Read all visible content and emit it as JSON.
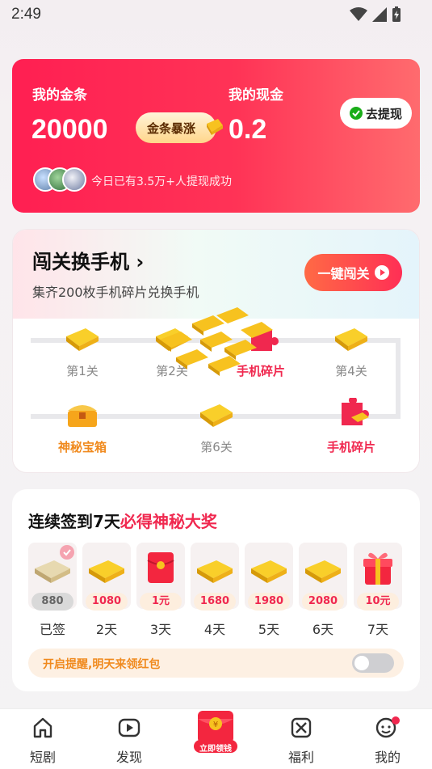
{
  "status_bar": {
    "time": "2:49"
  },
  "wallet": {
    "gold_label": "我的金条",
    "gold_value": "20000",
    "boom_badge": "金条暴涨",
    "cash_label": "我的现金",
    "cash_value": "0.2",
    "withdraw_label": "去提现",
    "success_text": "今日已有3.5万+人提现成功"
  },
  "level_challenge": {
    "title": "闯关换手机",
    "subtitle": "集齐200枚手机碎片兑换手机",
    "go_button": "一键闯关",
    "stages": [
      {
        "label": "第1关",
        "icon": "gold-bars-icon"
      },
      {
        "label": "第2关",
        "icon": "gold-bars-icon"
      },
      {
        "label": "手机碎片",
        "icon": "puzzle-piece-icon"
      },
      {
        "label": "第4关",
        "icon": "gold-bars-icon"
      },
      {
        "label": "神秘宝箱",
        "icon": "treasure-chest-icon"
      },
      {
        "label": "第6关",
        "icon": "gold-bars-icon"
      },
      {
        "label": "手机碎片",
        "icon": "puzzle-piece-icon"
      }
    ]
  },
  "checkin": {
    "title_prefix": "连续签到7天",
    "title_highlight": "必得神秘大奖",
    "days": [
      {
        "amount": "880",
        "label": "已签",
        "icon": "gold-bars-icon",
        "done": true
      },
      {
        "amount": "1080",
        "label": "2天",
        "icon": "gold-bars-icon"
      },
      {
        "amount": "1元",
        "label": "3天",
        "icon": "red-envelope-icon"
      },
      {
        "amount": "1680",
        "label": "4天",
        "icon": "gold-bars-icon"
      },
      {
        "amount": "1980",
        "label": "5天",
        "icon": "gold-bars-icon"
      },
      {
        "amount": "2080",
        "label": "6天",
        "icon": "gold-bars-icon"
      },
      {
        "amount": "10元",
        "label": "7天",
        "icon": "gift-box-icon"
      }
    ],
    "reminder_text": "开启提醒,明天来领红包",
    "reminder_on": false
  },
  "bottom_nav": {
    "items": [
      {
        "label": "短剧",
        "icon": "home-icon"
      },
      {
        "label": "发现",
        "icon": "play-icon"
      },
      {
        "label": "立即领钱",
        "icon": "red-envelope-icon"
      },
      {
        "label": "福利",
        "icon": "welfare-icon"
      },
      {
        "label": "我的",
        "icon": "profile-icon"
      }
    ]
  },
  "colors": {
    "brand_red": "#ff2f55",
    "accent_orange": "#f08a1e",
    "gold": "#f7c21f"
  }
}
